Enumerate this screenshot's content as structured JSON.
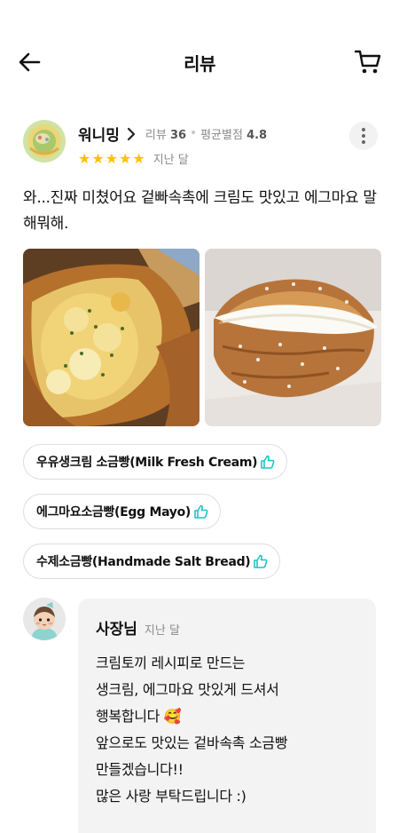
{
  "header": {
    "title": "리뷰",
    "back_icon": "arrow-left-icon",
    "cart_icon": "cart-icon"
  },
  "review": {
    "reviewer_name": "워니밍",
    "review_count_label": "리뷰",
    "review_count": "36",
    "avg_rating_label": "평균별점",
    "avg_rating": "4.8",
    "stars": 5,
    "date": "지난 달",
    "text": "와...진짜 미쳤어요 겉빠속촉에 크림도 맛있고 에그마요 말해뭐해.",
    "star_color": "#ffc107"
  },
  "menu_tags": [
    {
      "label": "우유생크림 소금빵(Milk Fresh Cream)"
    },
    {
      "label": "에그마요소금빵(Egg Mayo)"
    },
    {
      "label": "수제소금빵(Handmade Salt Bread)"
    }
  ],
  "owner_reply": {
    "name": "사장님",
    "date": "지난 달",
    "text": "크림토끼 레시피로 만드는\n생크림, 에그마요 맛있게 드셔서\n행복합니다 🥰\n앞으로도 맛있는 겉바속촉 소금빵\n만들겠습니다!!\n많은 사랑 부탁드립니다 :)"
  },
  "colors": {
    "accent_thumb": "#1fc3c3",
    "reply_bg": "#f3f3f3"
  }
}
